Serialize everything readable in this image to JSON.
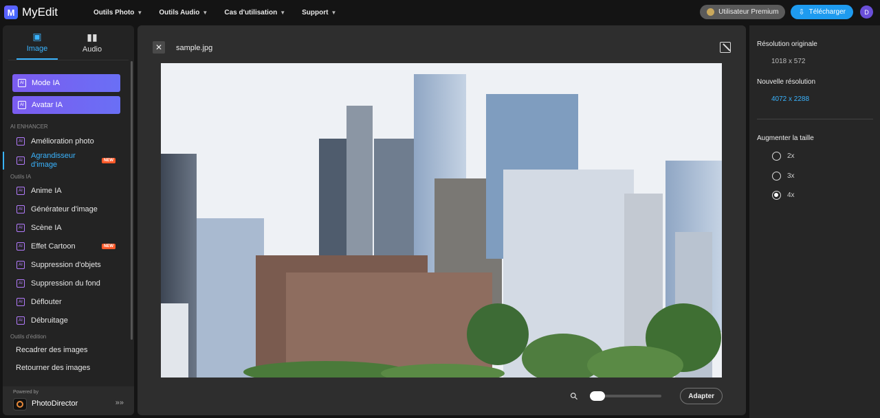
{
  "app": {
    "logo_letter": "M",
    "name": "MyEdit"
  },
  "nav": [
    {
      "label": "Outils Photo"
    },
    {
      "label": "Outils Audio"
    },
    {
      "label": "Cas d'utilisation"
    },
    {
      "label": "Support"
    }
  ],
  "header": {
    "premium_label": "Utilisateur Premium",
    "download_label": "Télécharger",
    "avatar_letter": "D"
  },
  "sidebar": {
    "tabs": [
      {
        "label": "Image"
      },
      {
        "label": "Audio"
      }
    ],
    "mode_buttons": [
      {
        "label": "Mode IA"
      },
      {
        "label": "Avatar IA"
      }
    ],
    "sections": {
      "enhancer": "AI ENHANCER",
      "tools": "Outils IA",
      "editing": "Outils d'édition"
    },
    "enhancer_items": [
      {
        "label": "Amélioration photo"
      },
      {
        "label": "Agrandisseur d'image",
        "badge": "NEW"
      }
    ],
    "tool_items": [
      {
        "label": "Anime IA"
      },
      {
        "label": "Générateur d'image"
      },
      {
        "label": "Scène IA"
      },
      {
        "label": "Effet Cartoon",
        "badge": "NEW"
      },
      {
        "label": "Suppression d'objets"
      },
      {
        "label": "Suppression du fond"
      },
      {
        "label": "Déflouter"
      },
      {
        "label": "Débruitage"
      }
    ],
    "edit_items": [
      {
        "label": "Recadrer des images"
      },
      {
        "label": "Retourner des images"
      }
    ],
    "powered_by": "Powered by",
    "powered_name": "PhotoDirector"
  },
  "editor": {
    "filename": "sample.jpg",
    "fit_label": "Adapter",
    "zoom_fraction": 0
  },
  "panel": {
    "original_label": "Résolution originale",
    "original_value": "1018  x  572",
    "new_label": "Nouvelle résolution",
    "new_value": "4072  x  2288",
    "upscale_label": "Augmenter la taille",
    "options": [
      {
        "label": "2x"
      },
      {
        "label": "3x"
      },
      {
        "label": "4x"
      }
    ],
    "selected_option": "4x"
  },
  "colors": {
    "accent": "#3ab4ff",
    "mode_gradient_start": "#7b5cf0",
    "download": "#1e9bef",
    "new_badge": "#ff5a2a"
  }
}
